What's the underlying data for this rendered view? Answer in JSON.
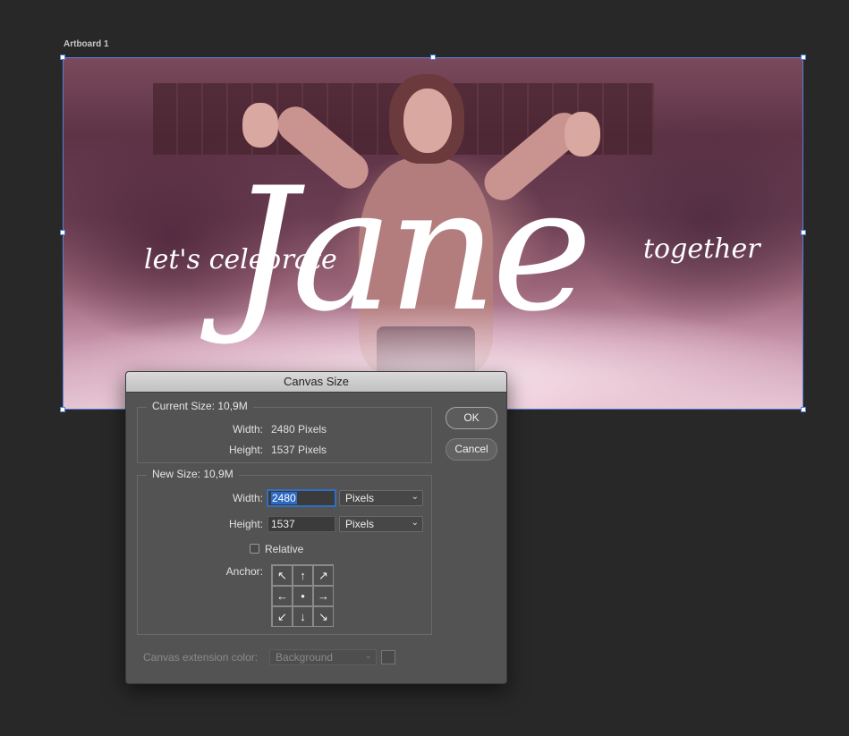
{
  "artboard": {
    "label": "Artboard 1",
    "text_left": "let's celebrate",
    "text_big": "Jane",
    "text_right": "together"
  },
  "dialog": {
    "title": "Canvas Size",
    "ok_label": "OK",
    "cancel_label": "Cancel",
    "current": {
      "title": "Current Size: 10,9M",
      "width_label": "Width:",
      "width_value": "2480 Pixels",
      "height_label": "Height:",
      "height_value": "1537 Pixels"
    },
    "new": {
      "title": "New Size: 10,9M",
      "width_label": "Width:",
      "width_value": "2480",
      "width_unit": "Pixels",
      "height_label": "Height:",
      "height_value": "1537",
      "height_unit": "Pixels",
      "relative_label": "Relative",
      "relative_checked": false,
      "anchor_label": "Anchor:",
      "anchor_arrows": [
        "↖",
        "↑",
        "↗",
        "←",
        "●",
        "→",
        "↙",
        "↓",
        "↘"
      ]
    },
    "extension": {
      "label": "Canvas extension color:",
      "value": "Background"
    }
  },
  "colors": {
    "background": "#282828",
    "dialog": "#535353",
    "selection": "#2e69c2",
    "artboard_border": "#5a7fd6"
  }
}
